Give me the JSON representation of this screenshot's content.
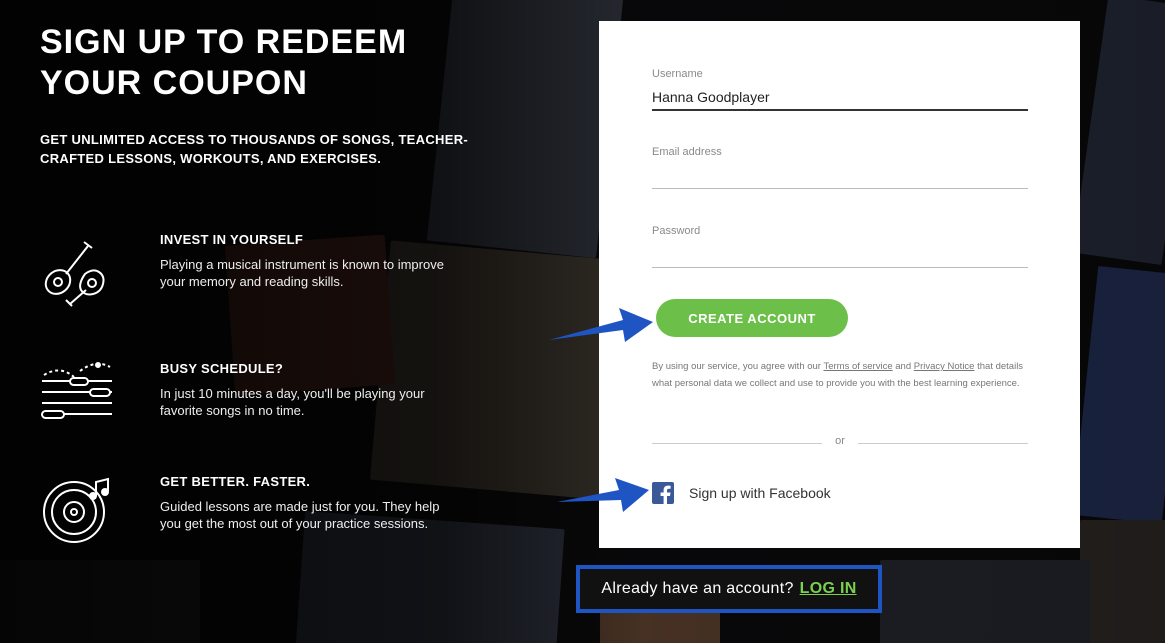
{
  "hero": {
    "title": "SIGN UP TO REDEEM YOUR COUPON",
    "subtitle": "GET UNLIMITED ACCESS TO THOUSANDS OF SONGS, TEACHER-CRAFTED LESSONS, WORKOUTS, AND EXERCISES."
  },
  "features": [
    {
      "icon": "guitars-icon",
      "title": "INVEST IN YOURSELF",
      "text": "Playing a musical instrument is known to improve your memory and reading skills."
    },
    {
      "icon": "schedule-sliders-icon",
      "title": "BUSY SCHEDULE?",
      "text": "In just 10 minutes a day, you'll be playing your favorite songs in no time."
    },
    {
      "icon": "record-music-icon",
      "title": "GET BETTER. FASTER.",
      "text": "Guided lessons are made just for you. They help you get the most out of your practice sessions."
    }
  ],
  "form": {
    "username": {
      "label": "Username",
      "value": "Hanna Goodplayer"
    },
    "email": {
      "label": "Email address",
      "value": ""
    },
    "password": {
      "label": "Password",
      "value": ""
    },
    "create_button": "CREATE ACCOUNT",
    "terms": {
      "prefix": "By using our service, you agree with our ",
      "terms_link": "Terms of service",
      "middle": " and ",
      "privacy_link": "Privacy Notice",
      "suffix": " that details what personal data we collect and use to provide you with the best learning experience."
    },
    "divider_text": "or",
    "facebook_button": "Sign up with Facebook"
  },
  "login": {
    "prompt": "Already have an account?",
    "link": "LOG IN"
  },
  "colors": {
    "accent_green": "#6cc04a",
    "link_green": "#7bd14e",
    "arrow_blue": "#1f55c3",
    "facebook_blue": "#3b5998"
  }
}
